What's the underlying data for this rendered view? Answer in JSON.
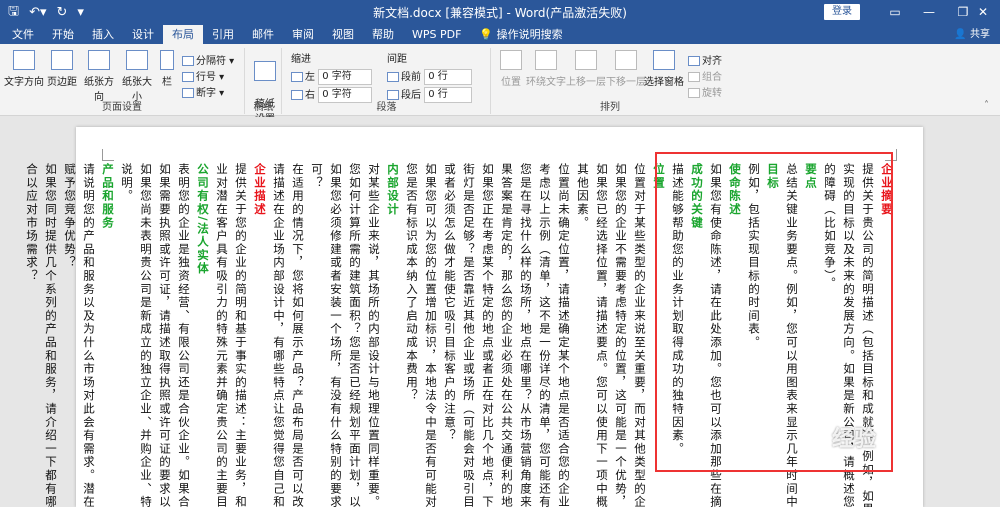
{
  "titlebar": {
    "title": "新文档.docx [兼容模式] - Word(产品激活失败)",
    "login": "登录",
    "save_icon": "save-icon",
    "undo_icon": "undo-icon",
    "redo_icon": "redo-icon"
  },
  "tabs": [
    "文件",
    "开始",
    "插入",
    "设计",
    "布局",
    "引用",
    "邮件",
    "审阅",
    "视图",
    "帮助",
    "WPS PDF",
    "操作说明搜索"
  ],
  "active_tab": "布局",
  "share": "共享",
  "ribbon": {
    "page_setup": {
      "label": "页面设置",
      "text_direction": "文字方向",
      "margins": "页边距",
      "orientation": "纸张方向",
      "size": "纸张大小",
      "columns": "栏",
      "breaks": "分隔符",
      "line_numbers": "行号",
      "hyphenation": "断字"
    },
    "draft": {
      "label": "稿纸",
      "button": "稿纸\n设置"
    },
    "paragraph": {
      "label": "段落",
      "indent": "缩进",
      "spacing": "间距",
      "left": "左",
      "right": "右",
      "before": "段前",
      "after": "段后",
      "left_val": "0 字符",
      "right_val": "0 字符",
      "before_val": "0 行",
      "after_val": "0 行"
    },
    "arrange": {
      "label": "排列",
      "position": "位置",
      "wrap": "环绕文字",
      "forward": "上移一层",
      "backward": "下移一层",
      "pane": "选择窗格",
      "align": "对齐",
      "group": "组合",
      "rotate": "旋转"
    }
  },
  "document": {
    "columns": [
      {
        "text": "企业摘要",
        "style": "head red"
      },
      {
        "text": "提供关于贵公司的简明描述（包括目标和成就）。例如，如果贵公司已存在多年，可",
        "style": ""
      },
      {
        "text": "实现的目标以及未来的发展方向。如果是新公司，请概述您的计划、开",
        "style": ""
      },
      {
        "text": "的障碍（比如竞争）。",
        "style": ""
      },
      {
        "text": "要点",
        "style": "head green"
      },
      {
        "text": "总结关键业务要点。例如，您可以用图表来显示几年时间中的销售额、",
        "style": ""
      },
      {
        "text": "目标",
        "style": "head green"
      },
      {
        "text": "例如，包括实现目标的时间表。",
        "style": ""
      },
      {
        "text": "使命陈述",
        "style": "head green"
      },
      {
        "text": "如果您有使命陈述，请在此处添加。您也可以添加那些在摘要的其他",
        "style": ""
      },
      {
        "text": "成功的关键",
        "style": "head green"
      },
      {
        "text": "描述能够帮助您的业务计划取得成功的独特因素。",
        "style": ""
      },
      {
        "text": "位置",
        "style": "head green"
      },
      {
        "text": "位置对于某些类型的企业来说至关重要，而对其他类型的企业而言则不",
        "style": ""
      },
      {
        "text": "如果您的企业不需要考虑特定的位置，这可能是一个优势，应在此处明",
        "style": ""
      },
      {
        "text": "如果您已经选择位置，请描述要点。您可以使用下一项中概括的问题来",
        "style": ""
      },
      {
        "text": "其他因素。",
        "style": ""
      },
      {
        "text": "位置尚未确定位置，请描述确定某个地点是否适合您的企业的主要标准",
        "style": ""
      },
      {
        "text": "考虑以上示例（清单，这不是一份详尽的清单，您可能还有其他考虑因",
        "style": ""
      },
      {
        "text": "您是在寻找什么样的场所，地点在哪里？从市场营销角度来讲，有没有",
        "style": ""
      },
      {
        "text": "果答案是肯定的，那么您的企业必须处在公共交通便利的地带吗？",
        "style": ""
      },
      {
        "text": "如果您正在考虑某个特定的地点或者正在对比几个地点，下面几点可能",
        "style": ""
      },
      {
        "text": "街灯是否足够？是否靠近其他企业或场所（可能会对吸引目标客户有所",
        "style": ""
      },
      {
        "text": "或者必须怎么做才能使它吸引目标客户的注意？",
        "style": ""
      },
      {
        "text": "如果您可以为您的位置增加标识，本地法令中是否有可能对您有负面影",
        "style": ""
      },
      {
        "text": "您是否有标识成本纳入了启动成本费用？",
        "style": ""
      },
      {
        "text": "内部设计",
        "style": "head green"
      },
      {
        "text": "对某些企业来说，其场所的内部设计与地理位置同样重要。如果您的企",
        "style": ""
      },
      {
        "text": "您如何计算所需的建筑面积？您是否已经规划平面计划，以确保最大",
        "style": ""
      },
      {
        "text": "如果您必须修建或者安装一个场所，有没有什么特别的要求/改动？如",
        "style": ""
      },
      {
        "text": "可？",
        "style": ""
      },
      {
        "text": "在适用的情况下，您将如何展示产品？产品布局是否可以改善商店气氛",
        "style": ""
      },
      {
        "text": "请描述在企业场内部设计中，有哪些特点让您觉得您自己和其他企业相",
        "style": ""
      },
      {
        "text": "企业描述",
        "style": "head red"
      },
      {
        "text": "提供关于您的企业的简明和基于事实的描述：主要业务，和使其与众不",
        "style": ""
      },
      {
        "text": "业对潜在客户具有吸引力的特殊元素并确定贵公司的主要目标。",
        "style": ""
      },
      {
        "text": "公司有权/法人实体",
        "style": "head green"
      },
      {
        "text": "表明您的企业是独资经营、有限公司还是合伙企业。如果合适，请明确",
        "style": ""
      },
      {
        "text": "如果需要执照或许可证，请描述取得执照或许可证的要求以及目前的",
        "style": ""
      },
      {
        "text": "如果您尚未表明贵公司是新成立的独立企业、并购企业、特许经营企业",
        "style": ""
      },
      {
        "text": "说明。",
        "style": ""
      },
      {
        "text": "产品和服务",
        "style": "head green"
      },
      {
        "text": "请说明您的产品和服务以及为什么市场对此会有需求。潜在市场是什么",
        "style": ""
      },
      {
        "text": "赋予您竞争优势？",
        "style": ""
      },
      {
        "text": "如果您同时提供几个系列的产品和服务，请介绍一下都有哪些。您为什",
        "style": ""
      },
      {
        "text": "合以应对市场需求？",
        "style": ""
      }
    ]
  },
  "watermark": "经验"
}
